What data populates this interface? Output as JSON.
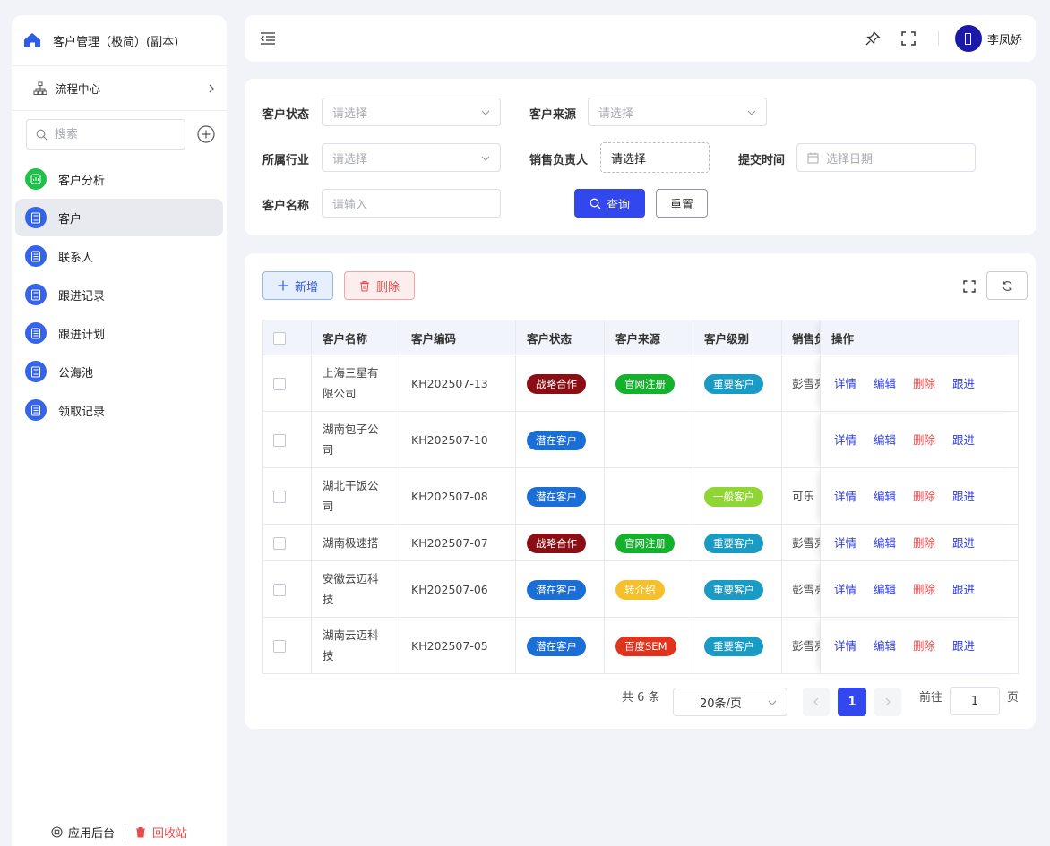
{
  "sidebar": {
    "app_title": "客户管理（极简）(副本)",
    "flow_label": "流程中心",
    "search_placeholder": "搜索",
    "menu": [
      {
        "label": "客户分析",
        "icon": "analytics-icon",
        "color": "#20c04b"
      },
      {
        "label": "客户",
        "icon": "document-icon",
        "color": "#3563e9",
        "active": true
      },
      {
        "label": "联系人",
        "icon": "document-icon",
        "color": "#3563e9"
      },
      {
        "label": "跟进记录",
        "icon": "document-icon",
        "color": "#3563e9"
      },
      {
        "label": "跟进计划",
        "icon": "document-icon",
        "color": "#3563e9"
      },
      {
        "label": "公海池",
        "icon": "document-icon",
        "color": "#3563e9"
      },
      {
        "label": "领取记录",
        "icon": "document-icon",
        "color": "#3563e9"
      }
    ],
    "footer": {
      "admin": "应用后台",
      "recycle": "回收站"
    }
  },
  "header": {
    "user_name": "李凤娇"
  },
  "filter": {
    "status_label": "客户状态",
    "status_placeholder": "请选择",
    "source_label": "客户来源",
    "source_placeholder": "请选择",
    "industry_label": "所属行业",
    "industry_placeholder": "请选择",
    "sales_label": "销售负责人",
    "sales_value": "请选择",
    "time_label": "提交时间",
    "time_placeholder": "选择日期",
    "name_label": "客户名称",
    "name_placeholder": "请输入",
    "query_btn": "查询",
    "reset_btn": "重置"
  },
  "toolbar": {
    "add": "新增",
    "delete": "删除"
  },
  "table": {
    "headers": [
      "客户名称",
      "客户编码",
      "客户状态",
      "客户来源",
      "客户级别",
      "销售负责人",
      "操作"
    ],
    "ops": [
      "详情",
      "编辑",
      "删除",
      "跟进"
    ],
    "rows": [
      {
        "name": "上海三星有限公司",
        "code": "KH202507-13",
        "status": "战略合作",
        "status_color": "#8b0e14",
        "source": "官网注册",
        "source_color": "#14b12d",
        "level": "重要客户",
        "level_color": "#1a9bc4",
        "sales": "彭雪亮"
      },
      {
        "name": "湖南包子公司",
        "code": "KH202507-10",
        "status": "潜在客户",
        "status_color": "#1b6ed6",
        "source": "",
        "source_color": "",
        "level": "",
        "level_color": "",
        "sales": ""
      },
      {
        "name": "湖北干饭公司",
        "code": "KH202507-08",
        "status": "潜在客户",
        "status_color": "#1b6ed6",
        "source": "",
        "source_color": "",
        "level": "一般客户",
        "level_color": "#8fd634",
        "sales": "可乐"
      },
      {
        "name": "湖南极速搭",
        "code": "KH202507-07",
        "status": "战略合作",
        "status_color": "#8b0e14",
        "source": "官网注册",
        "source_color": "#14b12d",
        "level": "重要客户",
        "level_color": "#1a9bc4",
        "sales": "彭雪亮"
      },
      {
        "name": "安徽云迈科技",
        "code": "KH202507-06",
        "status": "潜在客户",
        "status_color": "#1b6ed6",
        "source": "转介绍",
        "source_color": "#f5c02c",
        "level": "重要客户",
        "level_color": "#1a9bc4",
        "sales": "彭雪亮"
      },
      {
        "name": "湖南云迈科技",
        "code": "KH202507-05",
        "status": "潜在客户",
        "status_color": "#1b6ed6",
        "source": "百度SEM",
        "source_color": "#e0341f",
        "level": "重要客户",
        "level_color": "#1a9bc4",
        "sales": "彭雪亮"
      }
    ]
  },
  "pager": {
    "total": "共 6 条",
    "page_size": "20条/页",
    "current": "1",
    "goto": "前往",
    "goto_value": "1",
    "page_unit": "页"
  }
}
